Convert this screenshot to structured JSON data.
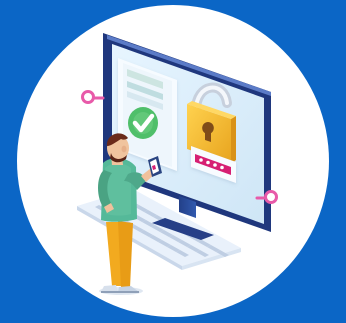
{
  "scene": {
    "background_color": "#0b66c6",
    "circle_color": "#ffffff",
    "monitor_frame_color": "#2f4fa0",
    "screen_color": "#dff0fb",
    "document_color": "#eef5fb",
    "check_color": "#4fbf6a",
    "lock_color": "#f0b52d",
    "shackle_color": "#c7d0dd",
    "password_bar_color": "#d61f73",
    "connector_color": "#e85aa9",
    "keyboard_color": "#e9f1fb",
    "person_shirt_color": "#55b999",
    "person_pants_color": "#f2aa1f",
    "person_hair_color": "#6a2a1a",
    "icons": [
      "monitor-icon",
      "document-icon",
      "checkmark-icon",
      "padlock-icon",
      "keyboard-icon",
      "smartphone-icon",
      "person-figure"
    ]
  }
}
